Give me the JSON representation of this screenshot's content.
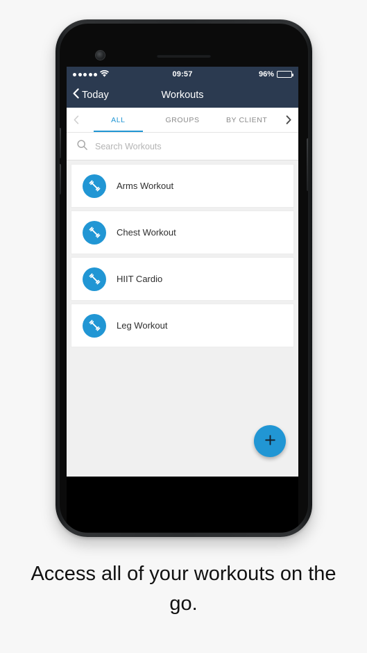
{
  "caption": "Access all of your workouts on the go.",
  "colors": {
    "accent": "#2196d4",
    "navbar": "#2b3a50",
    "screen_bg": "#f0f0f0",
    "card_bg": "#ffffff",
    "tab_inactive": "#8a8a8a"
  },
  "status_bar": {
    "signal_dots": 5,
    "wifi_icon": "wifi-icon",
    "time": "09:57",
    "battery_percent": "96%",
    "battery_level": 96
  },
  "nav_bar": {
    "back_icon": "chevron-left-icon",
    "back_label": "Today",
    "title": "Workouts"
  },
  "tab_bar": {
    "prev_icon": "chevron-left-icon",
    "next_icon": "chevron-right-icon",
    "tabs": [
      {
        "label": "ALL",
        "active": true
      },
      {
        "label": "GROUPS",
        "active": false
      },
      {
        "label": "BY CLIENT",
        "active": false
      }
    ]
  },
  "search": {
    "icon": "search-icon",
    "placeholder": "Search Workouts",
    "value": ""
  },
  "workout_list": {
    "items": [
      {
        "label": "Arms Workout",
        "icon": "dumbbell-icon"
      },
      {
        "label": "Chest Workout",
        "icon": "dumbbell-icon"
      },
      {
        "label": "HIIT Cardio",
        "icon": "dumbbell-icon"
      },
      {
        "label": "Leg Workout",
        "icon": "dumbbell-icon"
      }
    ]
  },
  "fab": {
    "icon": "plus-icon",
    "label": "+"
  }
}
